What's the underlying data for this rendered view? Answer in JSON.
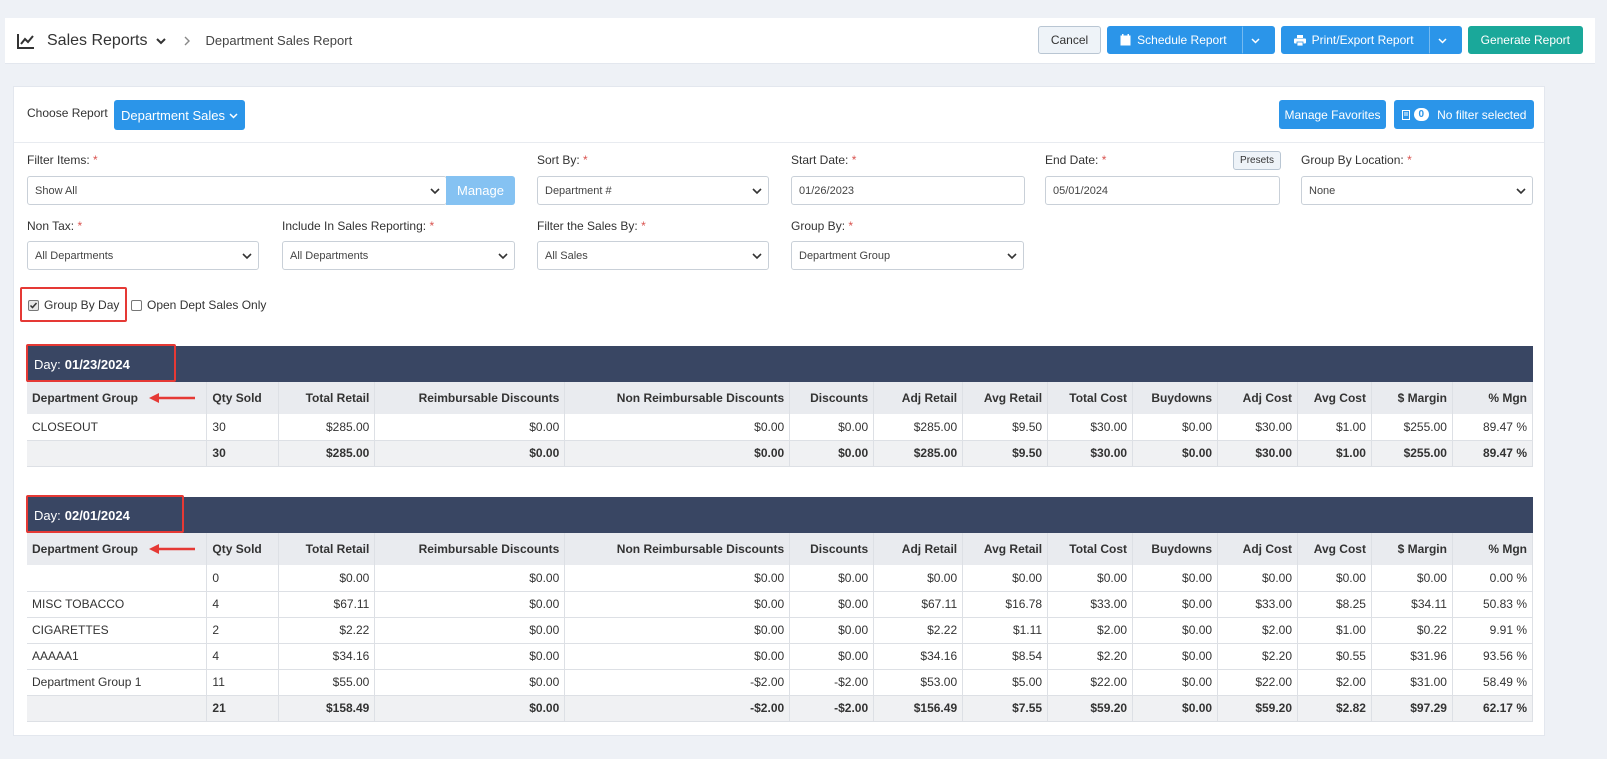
{
  "header": {
    "title": "Sales Reports",
    "breadcrumb": "Department Sales Report",
    "cancel": "Cancel",
    "schedule": "Schedule Report",
    "print": "Print/Export Report",
    "generate": "Generate Report"
  },
  "choose": {
    "label": "Choose Report",
    "report": "Department Sales",
    "manage_favorites": "Manage Favorites",
    "filter_count": "0",
    "no_filter": "No filter selected"
  },
  "filters": {
    "filter_items": {
      "label": "Filter Items:",
      "value": "Show All",
      "manage": "Manage"
    },
    "sort_by": {
      "label": "Sort By:",
      "value": "Department #"
    },
    "start_date": {
      "label": "Start Date:",
      "value": "01/26/2023"
    },
    "end_date": {
      "label": "End Date:",
      "value": "05/01/2024",
      "presets": "Presets"
    },
    "group_by_location": {
      "label": "Group By Location:",
      "value": "None"
    },
    "non_tax": {
      "label": "Non Tax:",
      "value": "All Departments"
    },
    "include_sales": {
      "label": "Include In Sales Reporting:",
      "value": "All Departments"
    },
    "filter_sales_by": {
      "label": "Filter the Sales By:",
      "value": "All Sales"
    },
    "group_by": {
      "label": "Group By:",
      "value": "Department Group"
    },
    "required_mark": "*"
  },
  "options": {
    "group_by_day": {
      "label": "Group By Day",
      "checked": true
    },
    "open_dept": {
      "label": "Open Dept Sales Only",
      "checked": false
    }
  },
  "columns": [
    "Department Group",
    "Qty Sold",
    "Total Retail",
    "Reimbursable Discounts",
    "Non Reimbursable Discounts",
    "Discounts",
    "Adj Retail",
    "Avg Retail",
    "Total Cost",
    "Buydowns",
    "Adj Cost",
    "Avg Cost",
    "$ Margin",
    "% Mgn"
  ],
  "day_prefix": "Day:",
  "days": [
    {
      "date": "01/23/2024",
      "rows": [
        [
          "CLOSEOUT",
          "30",
          "$285.00",
          "$0.00",
          "$0.00",
          "$0.00",
          "$285.00",
          "$9.50",
          "$30.00",
          "$0.00",
          "$30.00",
          "$1.00",
          "$255.00",
          "89.47 %"
        ]
      ],
      "total": [
        "",
        "30",
        "$285.00",
        "$0.00",
        "$0.00",
        "$0.00",
        "$285.00",
        "$9.50",
        "$30.00",
        "$0.00",
        "$30.00",
        "$1.00",
        "$255.00",
        "89.47 %"
      ]
    },
    {
      "date": "02/01/2024",
      "rows": [
        [
          "",
          "0",
          "$0.00",
          "$0.00",
          "$0.00",
          "$0.00",
          "$0.00",
          "$0.00",
          "$0.00",
          "$0.00",
          "$0.00",
          "$0.00",
          "$0.00",
          "0.00 %"
        ],
        [
          "MISC TOBACCO",
          "4",
          "$67.11",
          "$0.00",
          "$0.00",
          "$0.00",
          "$67.11",
          "$16.78",
          "$33.00",
          "$0.00",
          "$33.00",
          "$8.25",
          "$34.11",
          "50.83 %"
        ],
        [
          "CIGARETTES",
          "2",
          "$2.22",
          "$0.00",
          "$0.00",
          "$0.00",
          "$2.22",
          "$1.11",
          "$2.00",
          "$0.00",
          "$2.00",
          "$1.00",
          "$0.22",
          "9.91 %"
        ],
        [
          "AAAAA1",
          "4",
          "$34.16",
          "$0.00",
          "$0.00",
          "$0.00",
          "$34.16",
          "$8.54",
          "$2.20",
          "$0.00",
          "$2.20",
          "$0.55",
          "$31.96",
          "93.56 %"
        ],
        [
          "Department Group 1",
          "11",
          "$55.00",
          "$0.00",
          "-$2.00",
          "-$2.00",
          "$53.00",
          "$5.00",
          "$22.00",
          "$0.00",
          "$22.00",
          "$2.00",
          "$31.00",
          "58.49 %"
        ]
      ],
      "total": [
        "",
        "21",
        "$158.49",
        "$0.00",
        "-$2.00",
        "-$2.00",
        "$156.49",
        "$7.55",
        "$59.20",
        "$0.00",
        "$59.20",
        "$2.82",
        "$97.29",
        "62.17 %"
      ]
    }
  ],
  "colors": {
    "accent": "#2b95e9",
    "teal": "#1aa89a",
    "day_header": "#394663",
    "highlight": "#e53935"
  }
}
